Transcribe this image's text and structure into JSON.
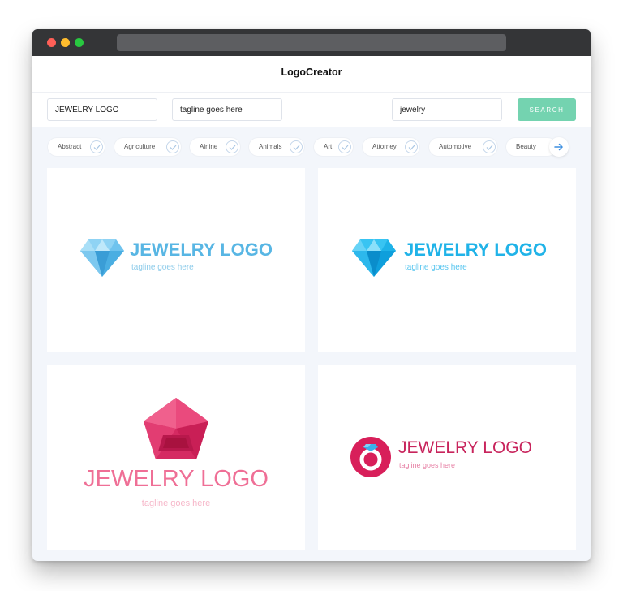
{
  "app": {
    "title": "LogoCreator"
  },
  "form": {
    "name_value": "JEWELRY LOGO",
    "tagline_value": "tagline goes here",
    "keyword_value": "jewelry",
    "search_label": "SEARCH"
  },
  "categories": [
    {
      "label": "Abstract"
    },
    {
      "label": "Agriculture"
    },
    {
      "label": "Airline"
    },
    {
      "label": "Animals"
    },
    {
      "label": "Art"
    },
    {
      "label": "Attorney"
    },
    {
      "label": "Automotive"
    },
    {
      "label": "Beauty"
    }
  ],
  "logos": [
    {
      "name": "JEWELRY LOGO",
      "tagline": "tagline goes here",
      "icon": "diamond-icon",
      "color": "#58b6e4"
    },
    {
      "name": "JEWELRY LOGO",
      "tagline": "tagline goes here",
      "icon": "diamond-icon",
      "color": "#20b3e8"
    },
    {
      "name": "JEWELRY LOGO",
      "tagline": "tagline goes here",
      "icon": "pentagon-gem-icon",
      "color": "#ef6f96"
    },
    {
      "name": "JEWELRY LOGO",
      "tagline": "tagline goes here",
      "icon": "ring-icon",
      "color": "#c8245c"
    }
  ],
  "colors": {
    "accent": "#74d3b0",
    "background": "#f3f6fb",
    "arrow": "#3d8fe0"
  }
}
